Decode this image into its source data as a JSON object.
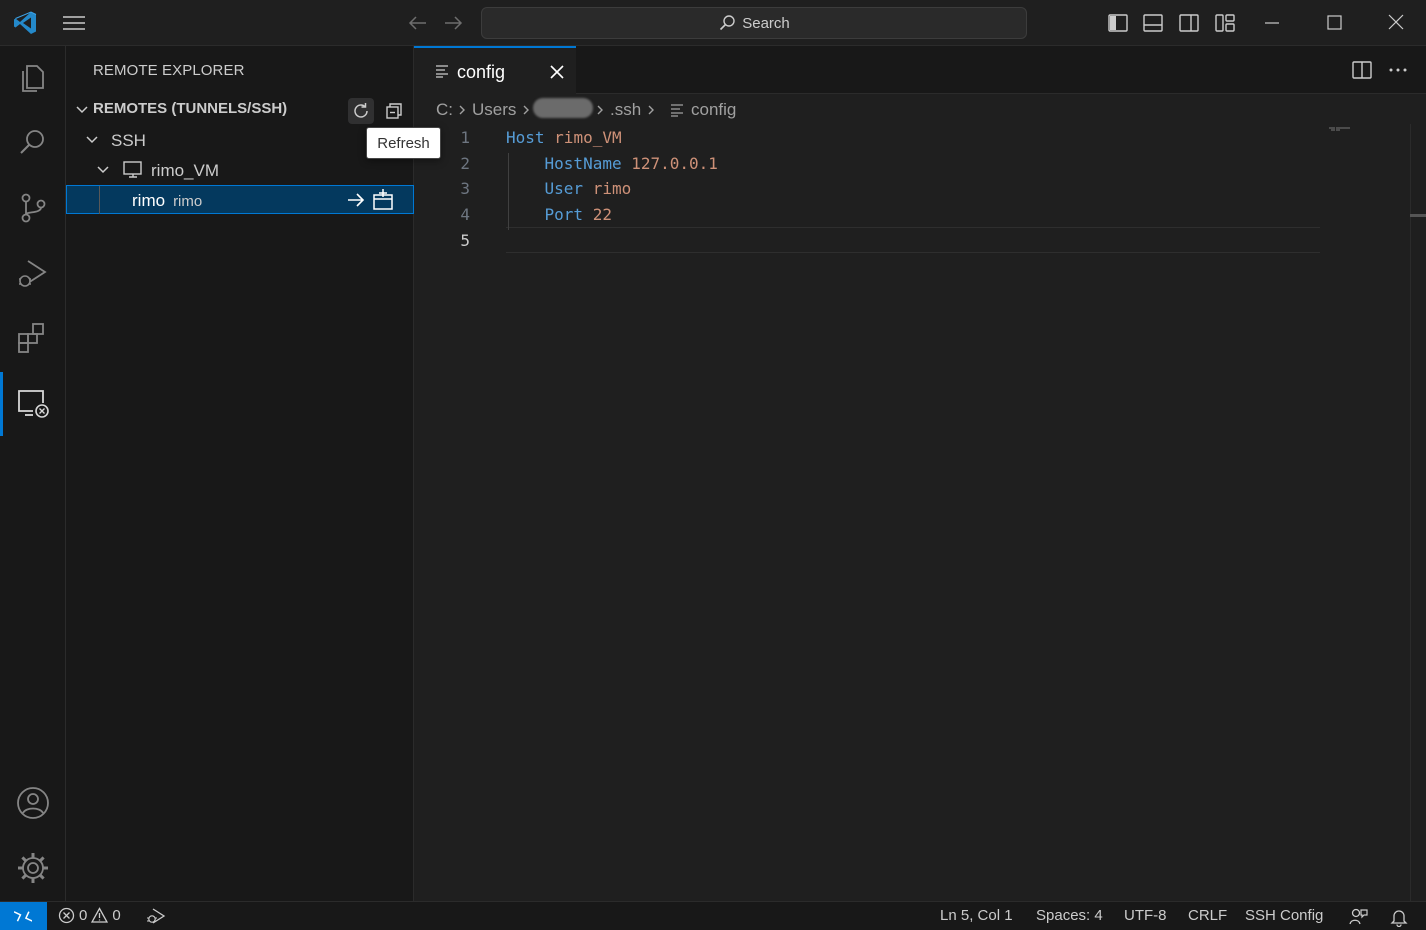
{
  "titlebar": {
    "search_placeholder": "Search"
  },
  "sidebar": {
    "title": "REMOTE EXPLORER",
    "section_header": "REMOTES (TUNNELS/SSH)",
    "tooltip": "Refresh",
    "tree": {
      "group": "SSH",
      "host": "rimo_VM",
      "target_label": "rimo",
      "target_description": "rimo"
    }
  },
  "editor": {
    "tab_label": "config",
    "breadcrumb": {
      "drive": "C:",
      "users": "Users",
      "folder": ".ssh",
      "file": "config"
    },
    "line_numbers": [
      "1",
      "2",
      "3",
      "4",
      "5"
    ],
    "lines": [
      {
        "key": "Host",
        "value": "rimo_VM"
      },
      {
        "key": "HostName",
        "value": "127.0.0.1"
      },
      {
        "key": "User",
        "value": "rimo"
      },
      {
        "key": "Port",
        "value": "22"
      }
    ]
  },
  "statusbar": {
    "errors": "0",
    "warnings": "0",
    "cursor": "Ln 5, Col 1",
    "indentation": "Spaces: 4",
    "encoding": "UTF-8",
    "eol": "CRLF",
    "language": "SSH Config"
  },
  "colors": {
    "accent": "#0078d4",
    "keyword": "#569cd6",
    "string": "#ce9178",
    "number": "#b5cea8"
  }
}
